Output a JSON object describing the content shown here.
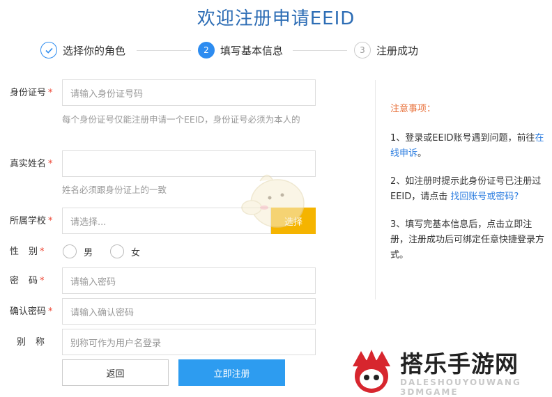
{
  "page_title": "欢迎注册申请EEID",
  "steps": [
    {
      "num": "",
      "label": "选择你的角色",
      "state": "done"
    },
    {
      "num": "2",
      "label": "填写基本信息",
      "state": "active"
    },
    {
      "num": "3",
      "label": "注册成功",
      "state": "pending"
    }
  ],
  "form": {
    "id_card": {
      "label": "身份证号",
      "placeholder": "请输入身份证号码",
      "hint": "每个身份证号仅能注册申请一个EEID，身份证号必须为本人的"
    },
    "real_name": {
      "label": "真实姓名",
      "placeholder": "",
      "hint": "姓名必须跟身份证上的一致"
    },
    "school": {
      "label": "所属学校",
      "placeholder": "请选择...",
      "button": "选择"
    },
    "gender": {
      "label": "性别",
      "options": [
        "男",
        "女"
      ]
    },
    "password": {
      "label": "密码",
      "placeholder": "请输入密码"
    },
    "confirm_password": {
      "label": "确认密码",
      "placeholder": "请输入确认密码"
    },
    "nickname": {
      "label": "别称",
      "placeholder": "别称可作为用户名登录"
    },
    "required_mark": "*"
  },
  "buttons": {
    "back": "返回",
    "submit": "立即注册"
  },
  "notes": {
    "head": "注意事项：",
    "item1_text": "1、登录或EEID账号遇到问题，前往",
    "item1_link": "在线申诉",
    "item1_tail": "。",
    "item2_text": "2、如注册时提示此身份证号已注册过EEID，请点击",
    "item2_link": "找回账号或密码?",
    "item3_text": "3、填写完基本信息后，点击立即注册，注册成功后可绑定任意快捷登录方式。"
  },
  "watermark": {
    "title": "搭乐手游网",
    "subtitle": "DALESHOUYOUWANG 3DMGAME"
  },
  "colors": {
    "accent": "#2d8cf0",
    "title": "#2d6db5",
    "select_button": "#f5b400",
    "note_head": "#e8703a",
    "required": "#e43333"
  }
}
